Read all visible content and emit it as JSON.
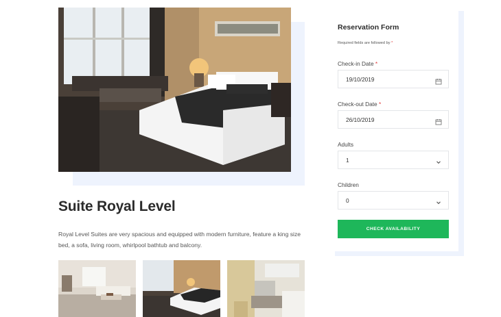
{
  "room": {
    "title": "Suite Royal Level",
    "description": "Royal Level Suites are very spacious and equipped with modern furniture, feature a king size bed, a sofa, living room, whirlpool bathtub and balcony."
  },
  "form": {
    "title": "Reservation Form",
    "required_note": "Required fields are followed by",
    "required_mark": "*",
    "checkin": {
      "label": "Check-in Date",
      "value": "19/10/2019",
      "icon": "calendar-icon"
    },
    "checkout": {
      "label": "Check-out Date",
      "value": "26/10/2019",
      "icon": "calendar-icon"
    },
    "adults": {
      "label": "Adults",
      "value": "1",
      "icon": "chevron-down-icon"
    },
    "children": {
      "label": "Children",
      "value": "0",
      "icon": "chevron-down-icon"
    },
    "submit_label": "CHECK AVAILABILITY"
  },
  "colors": {
    "accent": "#1eb75a",
    "required": "#e03b3b",
    "panel_shadow": "#eef3fd"
  }
}
